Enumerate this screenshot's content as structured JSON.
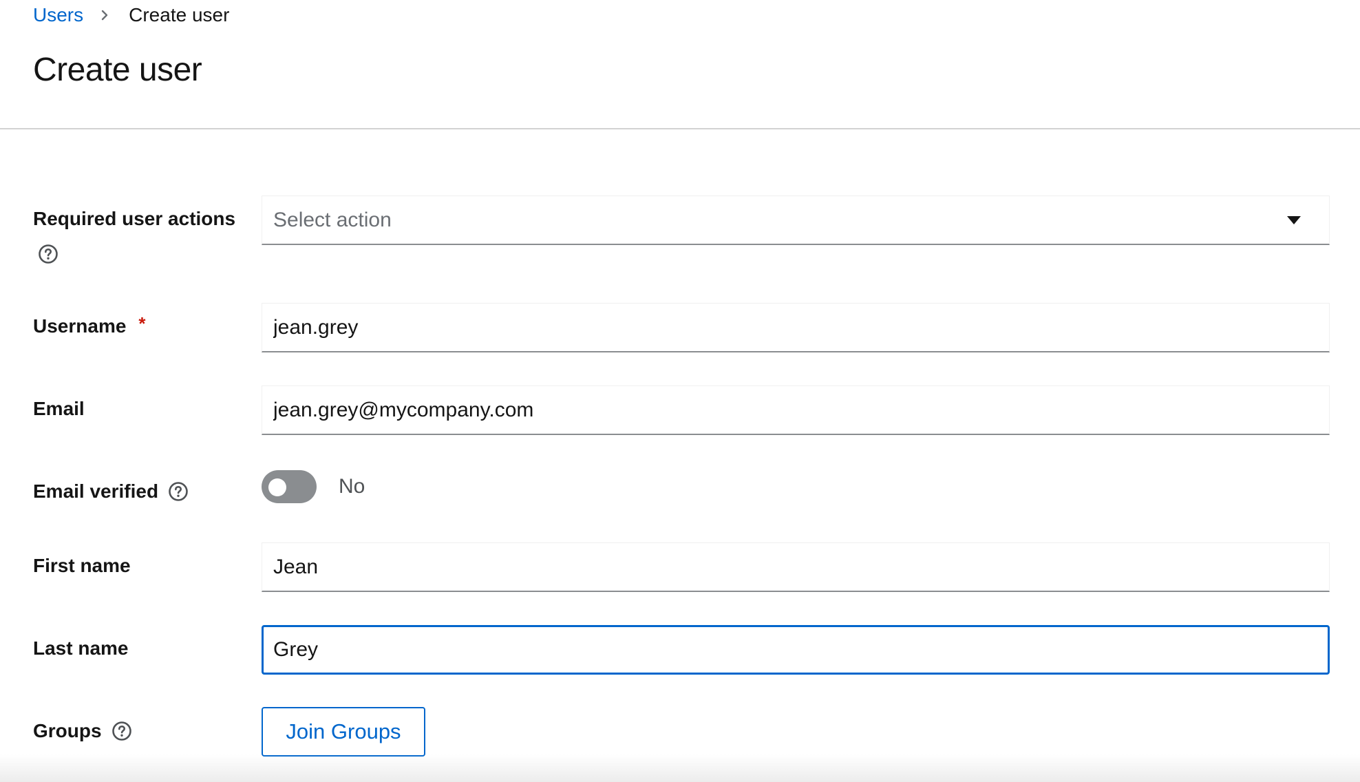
{
  "breadcrumb": {
    "parent": "Users",
    "current": "Create user"
  },
  "page": {
    "title": "Create user"
  },
  "form": {
    "required_actions": {
      "label": "Required user actions",
      "placeholder": "Select action"
    },
    "username": {
      "label": "Username",
      "required_mark": "*",
      "value": "jean.grey"
    },
    "email": {
      "label": "Email",
      "value": "jean.grey@mycompany.com"
    },
    "email_verified": {
      "label": "Email verified",
      "state_label": "No",
      "checked": false
    },
    "first_name": {
      "label": "First name",
      "value": "Jean"
    },
    "last_name": {
      "label": "Last name",
      "value": "Grey"
    },
    "groups": {
      "label": "Groups",
      "button_label": "Join Groups"
    }
  },
  "colors": {
    "link": "#0066cc",
    "required": "#c9190b",
    "focus_border": "#0066cc",
    "toggle_off": "#8a8d90"
  },
  "icons": {
    "breadcrumb_separator": "chevron-right-icon",
    "help": "help-circle-icon",
    "dropdown": "caret-down-icon"
  }
}
